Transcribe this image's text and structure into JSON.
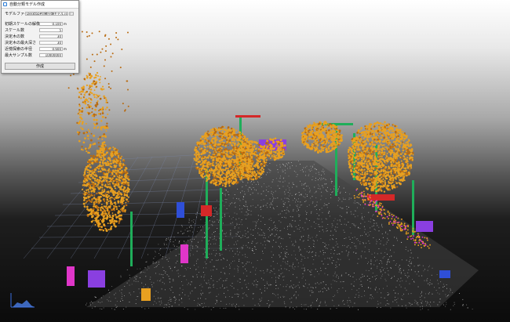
{
  "dialog": {
    "title": "自動分類モデル作成",
    "model_file": {
      "label": "モデルファイル",
      "value": "Desktop¥自動分類モデル.json",
      "browse_label": "🗁"
    },
    "params": [
      {
        "key": "initial_scale_resolution",
        "label": "初期スケールの解像度",
        "value": "0.100",
        "unit": "m"
      },
      {
        "key": "scale_count",
        "label": "スケール数",
        "value": "5",
        "unit": ""
      },
      {
        "key": "tree_count",
        "label": "決定木の数",
        "value": "30",
        "unit": ""
      },
      {
        "key": "max_tree_depth",
        "label": "決定木の最大深さ",
        "value": "30",
        "unit": ""
      },
      {
        "key": "neighbor_radius",
        "label": "近傍探索の半径",
        "value": "0.600",
        "unit": "m"
      },
      {
        "key": "max_sample_count",
        "label": "最大サンプル数",
        "value": "10000000",
        "unit": ""
      }
    ],
    "run_button": "作成"
  },
  "viewport": {
    "colors": {
      "ground": "#d9d9d9",
      "vegetation": "#e8a020",
      "vegetation_dark": "#b86a10",
      "pole": "#1fae5a",
      "sign": "#d42828",
      "vehicle": "#8a3fe0",
      "misc_blue": "#2f4fd8",
      "misc_magenta": "#e036c8",
      "grid": "#7a86a8",
      "axis": "#3a6fe0"
    }
  }
}
